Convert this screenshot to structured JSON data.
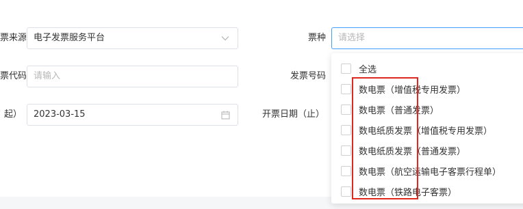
{
  "form": {
    "source_label": "票来源",
    "source_value": "电子发票服务平台",
    "type_label": "票种",
    "type_placeholder": "请选择",
    "code_label": "票代码",
    "code_placeholder": "请输入",
    "number_label": "发票号码",
    "date_start_label": "起）",
    "date_start_value": "2023-03-15",
    "date_end_label": "开票日期（止）"
  },
  "dropdown": {
    "options": [
      {
        "label": "全选"
      },
      {
        "label": "数电票（增值税专用发票）"
      },
      {
        "label": "数电票（普通发票）"
      },
      {
        "label": "数电纸质发票（增值税专用发票）"
      },
      {
        "label": "数电纸质发票（普通发票）"
      },
      {
        "label": "数电票（航空运输电子客票行程单）"
      },
      {
        "label": "数电票（铁路电子客票）"
      }
    ]
  },
  "colors": {
    "focus_border": "#409eff",
    "highlight": "#e0271d"
  },
  "icons": {
    "source_select": "chevron-down-icon",
    "date_field": "calendar-icon"
  }
}
